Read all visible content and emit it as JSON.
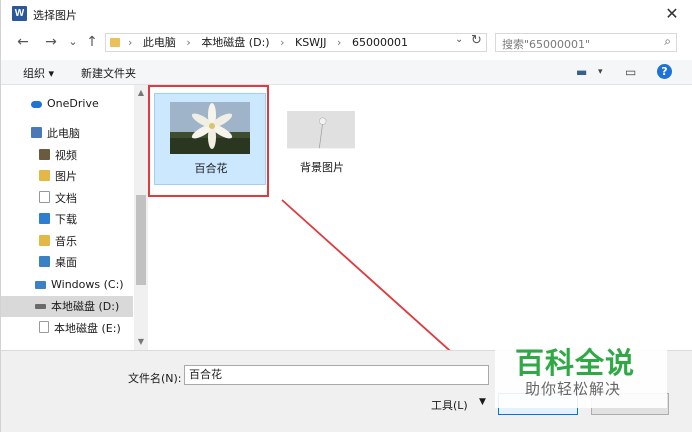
{
  "window": {
    "title": "选择图片",
    "app_icon_letter": "W",
    "close_glyph": "✕"
  },
  "nav": {
    "back": "←",
    "forward": "→",
    "history": "⌄",
    "up": "↑"
  },
  "address": {
    "crumbs": [
      "此电脑",
      "本地磁盘 (D:)",
      "KSWJJ",
      "65000001"
    ],
    "separator": "›",
    "dropdown": "⌄",
    "refresh": "↻"
  },
  "search": {
    "placeholder": "搜索\"65000001\"",
    "icon": "⌕"
  },
  "toolbar": {
    "organize": "组织 ▾",
    "new_folder": "新建文件夹",
    "view_icon": "▬",
    "view_dd": "▾",
    "pane_icon": "▭",
    "help": "?"
  },
  "sidebar": {
    "items": [
      {
        "label": "OneDrive",
        "icon": "cloud-icon",
        "color": "#1e73d6"
      },
      {
        "label": "此电脑",
        "icon": "computer-icon",
        "color": "#4a79b8"
      },
      {
        "label": "视频",
        "icon": "video-folder-icon",
        "color": "#6b5b3e"
      },
      {
        "label": "图片",
        "icon": "pictures-folder-icon",
        "color": "#e2b846"
      },
      {
        "label": "文档",
        "icon": "documents-folder-icon",
        "color": "#8e9aa8"
      },
      {
        "label": "下载",
        "icon": "downloads-folder-icon",
        "color": "#2f7fd0"
      },
      {
        "label": "音乐",
        "icon": "music-folder-icon",
        "color": "#e2b846"
      },
      {
        "label": "桌面",
        "icon": "desktop-folder-icon",
        "color": "#3b82c4"
      },
      {
        "label": "Windows (C:)",
        "icon": "windows-drive-icon",
        "color": "#3b82c4"
      },
      {
        "label": "本地磁盘 (D:)",
        "icon": "drive-icon",
        "color": "#6a6a6a"
      },
      {
        "label": "本地磁盘 (E:)",
        "icon": "drive-icon",
        "color": "#9a9a9a"
      }
    ],
    "scroll_up": "▲",
    "scroll_down": "▼"
  },
  "files": [
    {
      "name": "百合花",
      "selected": true
    },
    {
      "name": "背景图片",
      "selected": false
    }
  ],
  "bottom": {
    "filename_label": "文件名(N):",
    "filename_value": "百合花",
    "tools_label": "工具(L)",
    "tools_arrow": "▼"
  },
  "watermark": {
    "main": "百科全说",
    "sub": "助你轻松解决"
  },
  "colors": {
    "accent": "#0078d7",
    "annotation_red": "#e0393e",
    "watermark_green": "#2fa945"
  }
}
